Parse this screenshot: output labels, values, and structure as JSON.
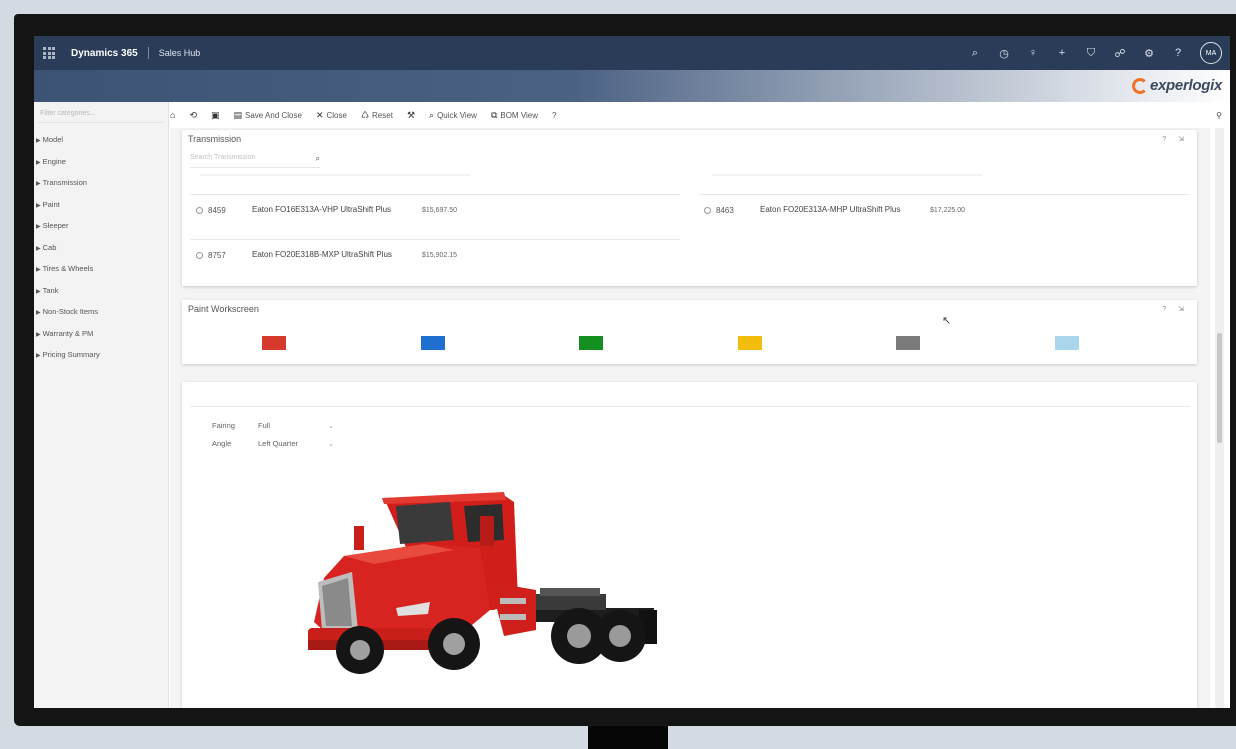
{
  "topbar": {
    "app_title": "Dynamics 365",
    "app_area": "Sales Hub",
    "icons": [
      "search-icon",
      "task-icon",
      "lightbulb-icon",
      "plus-icon",
      "filter-icon",
      "assist-icon",
      "settings-icon",
      "help-icon"
    ],
    "icon_glyphs": [
      "⌕",
      "◷",
      "♀",
      "+",
      "⛉",
      "☍",
      "⚙",
      "?"
    ],
    "avatar": "MA"
  },
  "brand": {
    "name": "experlogix",
    "color": "#f0712a"
  },
  "sidebar": {
    "filter_placeholder": "Filter categories...",
    "items": [
      {
        "label": "Model"
      },
      {
        "label": "Engine"
      },
      {
        "label": "Transmission"
      },
      {
        "label": "Paint"
      },
      {
        "label": "Sleeper"
      },
      {
        "label": "Cab"
      },
      {
        "label": "Tires & Wheels"
      },
      {
        "label": "Tank"
      },
      {
        "label": "Non-Stock Items"
      },
      {
        "label": "Warranty & PM"
      },
      {
        "label": "Pricing Summary"
      }
    ]
  },
  "toolbar": {
    "save_and_close": "Save And Close",
    "close": "Close",
    "reset": "Reset",
    "quick_view": "Quick View",
    "bom_view": "BOM View",
    "help": "?"
  },
  "transmission": {
    "title": "Transmission",
    "search_placeholder": "Search Transmission",
    "options": [
      {
        "code": "8459",
        "desc": "Eaton FO16E313A-VHP UltraShift Plus",
        "price": "$15,697.50"
      },
      {
        "code": "8463",
        "desc": "Eaton FO20E313A-MHP UltraShift Plus",
        "price": "$17,225.00"
      },
      {
        "code": "8757",
        "desc": "Eaton FO20E318B-MXP UltraShift Plus",
        "price": "$15,902.15"
      }
    ]
  },
  "paint": {
    "title": "Paint Workscreen",
    "swatches": [
      "#d63a2c",
      "#1f6fd0",
      "#13901f",
      "#f2bd0c",
      "#7a7a7a",
      "#a9d6ea"
    ]
  },
  "viewer": {
    "fairing_label": "Fairing",
    "fairing_value": "Full",
    "angle_label": "Angle",
    "angle_value": "Left Quarter"
  },
  "panel_icons": "? ⇲"
}
